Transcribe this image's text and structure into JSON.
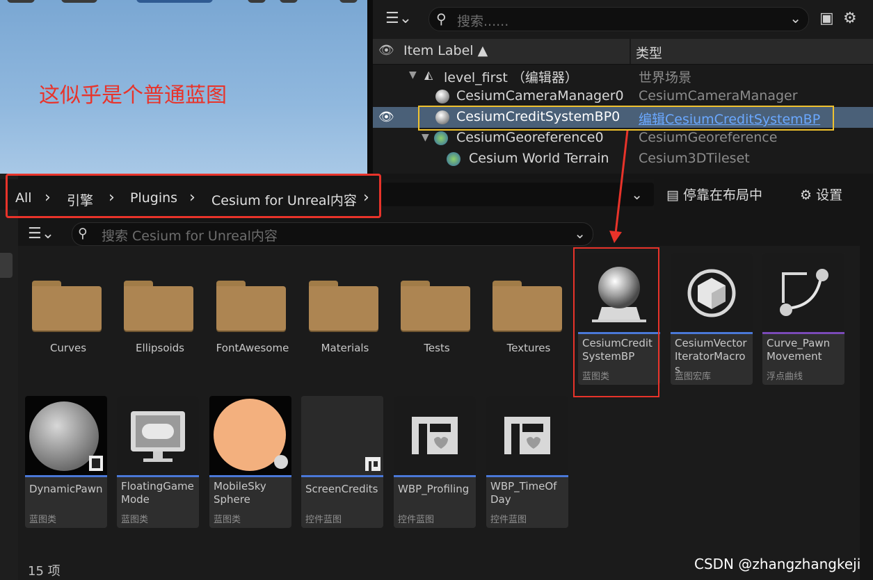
{
  "viewport": {
    "annotation": "这似乎是个普通蓝图"
  },
  "outliner": {
    "search_placeholder": "搜索......",
    "columns": {
      "label": "Item Label ▲",
      "type": "类型"
    },
    "rows": [
      {
        "label": "level_first （编辑器）",
        "type": "世界场景"
      },
      {
        "label": "CesiumCameraManager0",
        "type": "CesiumCameraManager"
      },
      {
        "label": "CesiumCreditSystemBP0",
        "type": "编辑CesiumCreditSystemBP"
      },
      {
        "label": "CesiumGeoreference0",
        "type": "CesiumGeoreference"
      },
      {
        "label": "Cesium World Terrain",
        "type": "Cesium3DTileset"
      }
    ]
  },
  "content_browser": {
    "breadcrumbs": [
      "All",
      "引擎",
      "Plugins",
      "Cesium for Unreal内容"
    ],
    "dock_label": "停靠在布局中",
    "settings_label": "设置",
    "search_placeholder": "搜索 Cesium for Unreal内容",
    "folders": [
      "Curves",
      "Ellipsoids",
      "FontAwesome",
      "Materials",
      "Tests",
      "Textures"
    ],
    "assets_row1": [
      {
        "name": "CesiumCredit SystemBP",
        "type": "蓝图类",
        "bar": "#4a78d8"
      },
      {
        "name": "CesiumVector IteratorMacros",
        "type": "蓝图宏库",
        "bar": "#4a78d8"
      },
      {
        "name": "Curve_Pawn Movement",
        "type": "浮点曲线",
        "bar": "#7a4ab8"
      }
    ],
    "assets_row2": [
      {
        "name": "DynamicPawn",
        "type": "蓝图类",
        "bar": "#4a78d8"
      },
      {
        "name": "FloatingGame Mode",
        "type": "蓝图类",
        "bar": "#4a78d8"
      },
      {
        "name": "MobileSky Sphere",
        "type": "蓝图类",
        "bar": "#4a78d8"
      },
      {
        "name": "ScreenCredits",
        "type": "控件蓝图",
        "bar": "#4a78d8"
      },
      {
        "name": "WBP_Profiling",
        "type": "控件蓝图",
        "bar": "#4a78d8"
      },
      {
        "name": "WBP_TimeOf Day",
        "type": "控件蓝图",
        "bar": "#4a78d8"
      }
    ],
    "item_count": "15 项"
  },
  "watermark": "CSDN @zhangzhangkeji"
}
